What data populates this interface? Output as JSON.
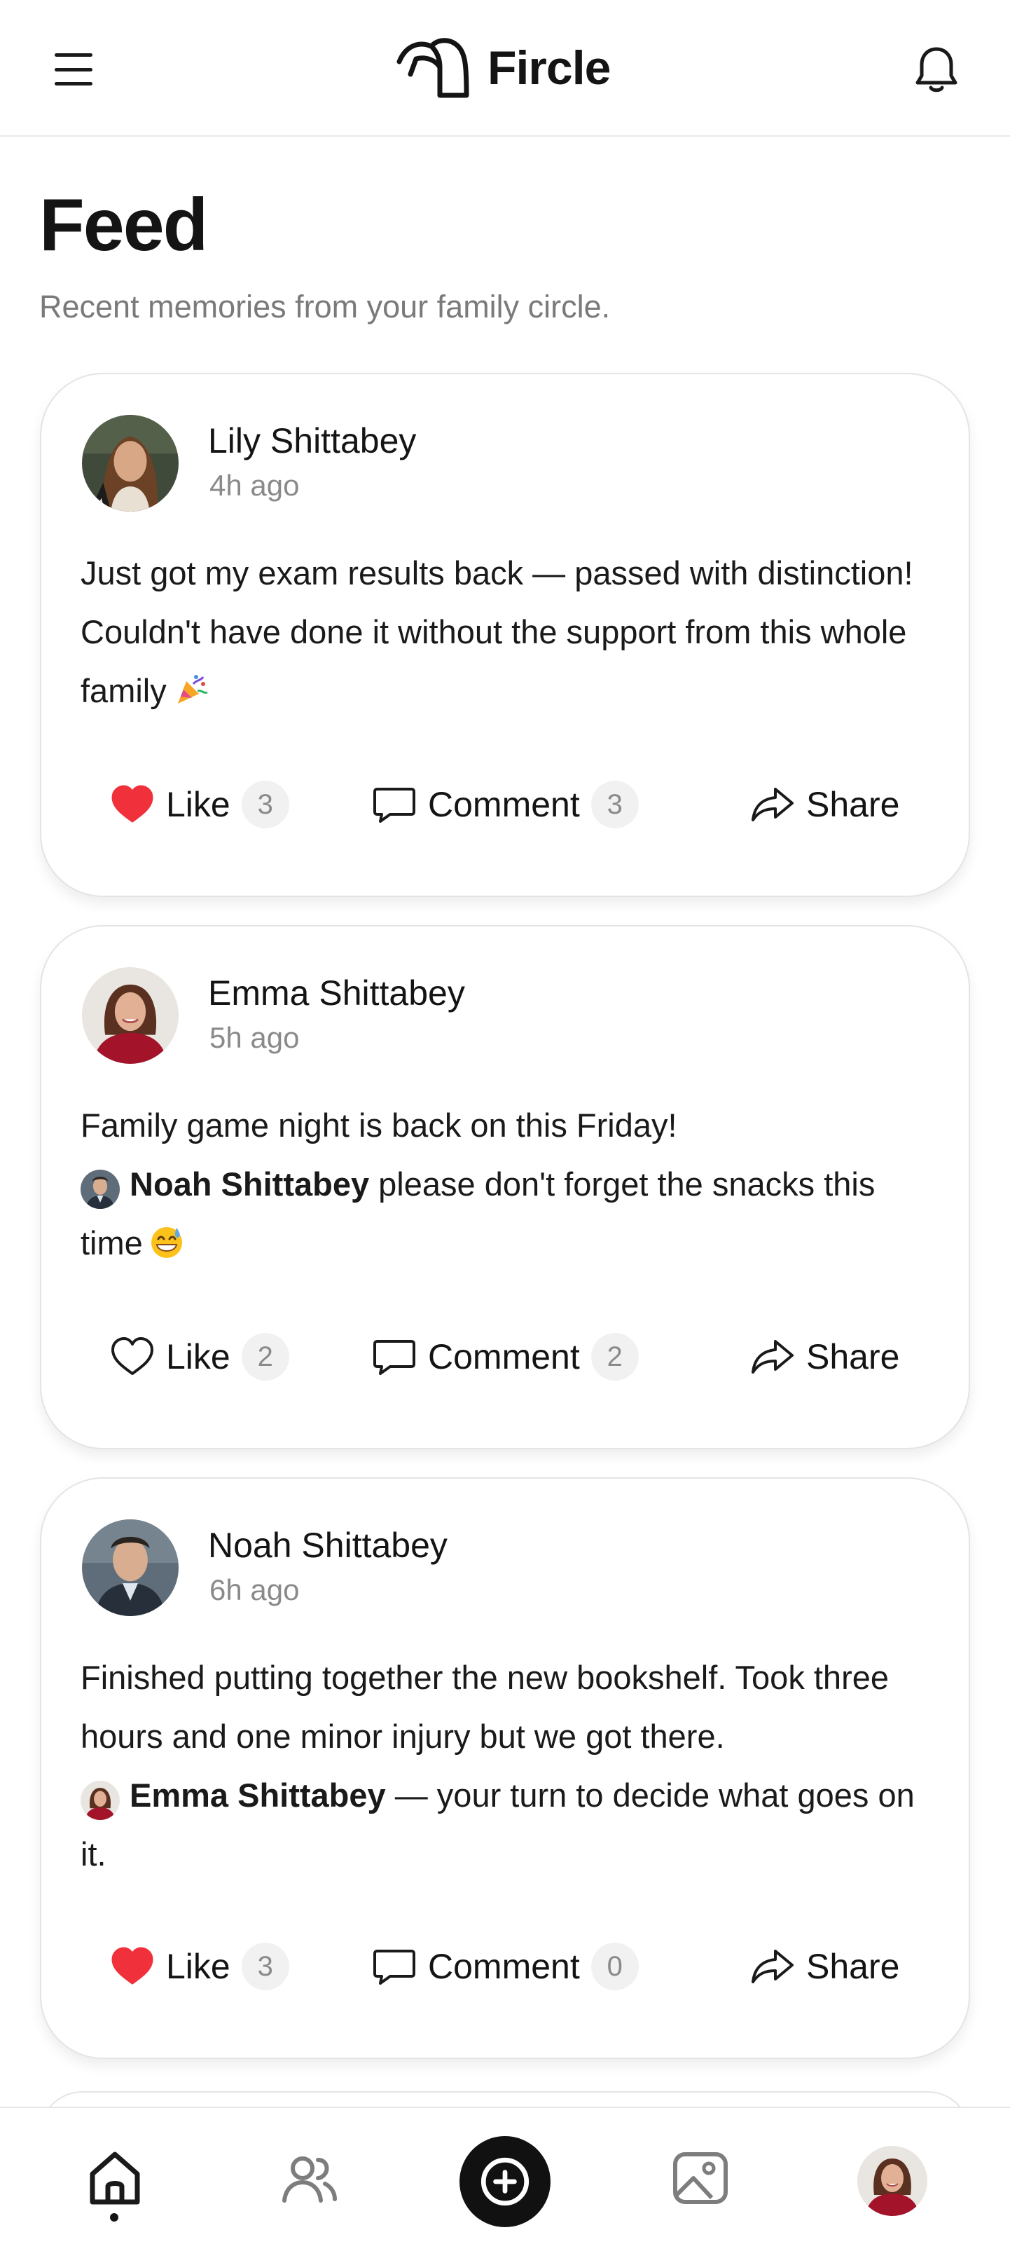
{
  "app": {
    "name": "Fircle"
  },
  "feed": {
    "title": "Feed",
    "subtitle": "Recent memories from your family circle."
  },
  "posts": [
    {
      "author": "Lily Shittabey",
      "time": "4h ago",
      "text": "Just got my exam results back — passed with distinction! Couldn't have done it without the support from this whole family",
      "emoji": "party-popper",
      "liked": true,
      "like_label": "Like",
      "like_count": "3",
      "comment_label": "Comment",
      "comment_count": "3",
      "share_label": "Share"
    },
    {
      "author": "Emma Shittabey",
      "time": "5h ago",
      "text_before": "Family game night is back on this Friday!",
      "mention": "Noah Shittabey",
      "text_after": "please don't forget the snacks this time",
      "emoji": "grinning-sweat",
      "liked": false,
      "like_label": "Like",
      "like_count": "2",
      "comment_label": "Comment",
      "comment_count": "2",
      "share_label": "Share"
    },
    {
      "author": "Noah Shittabey",
      "time": "6h ago",
      "text_before": "Finished putting together the new bookshelf. Took three hours and one minor injury but we got there.",
      "mention": "Emma Shittabey",
      "text_after": "— your turn to decide what goes on it.",
      "liked": true,
      "like_label": "Like",
      "like_count": "3",
      "comment_label": "Comment",
      "comment_count": "0",
      "share_label": "Share"
    }
  ],
  "icons": {
    "menu": "hamburger-icon",
    "logo": "fircle-logo-icon",
    "notifications": "bell-icon",
    "like": "heart-icon",
    "comment": "speech-bubble-icon",
    "share": "share-arrow-icon",
    "home": "home-icon",
    "people": "people-icon",
    "create": "plus-circle-icon",
    "gallery": "image-icon"
  },
  "colors": {
    "accent": "#111111",
    "like_active": "#f0303a",
    "muted_text": "#7a7a7a"
  }
}
